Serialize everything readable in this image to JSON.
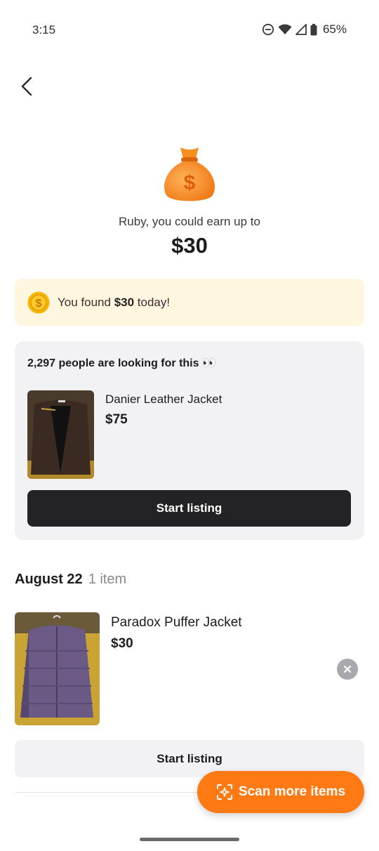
{
  "status_bar": {
    "time": "3:15",
    "battery_percent": "65%",
    "icons": [
      "do-not-disturb-icon",
      "wifi-icon",
      "cell-signal-icon",
      "battery-icon"
    ]
  },
  "header": {
    "back_icon": "back-arrow-icon"
  },
  "hero": {
    "icon": "money-bag-icon",
    "earn_text": "Ruby, you could earn up to",
    "earn_amount": "$30"
  },
  "found_banner": {
    "icon": "coin-icon",
    "prefix": "You found ",
    "amount": "$30",
    "suffix": " today!",
    "background_color": "#fff6e0"
  },
  "demand_card": {
    "title": "2,297 people are looking for this 👀",
    "item_name": "Danier Leather Jacket",
    "item_price": "$75",
    "button_label": "Start listing"
  },
  "date_group": {
    "date": "August 22",
    "count": "1 item",
    "items": [
      {
        "name": "Paradox Puffer Jacket",
        "price": "$30",
        "button_label": "Start listing"
      }
    ]
  },
  "scan_button": {
    "label": "Scan more items",
    "icon": "scan-sparkle-icon",
    "color": "#ff7a14"
  }
}
